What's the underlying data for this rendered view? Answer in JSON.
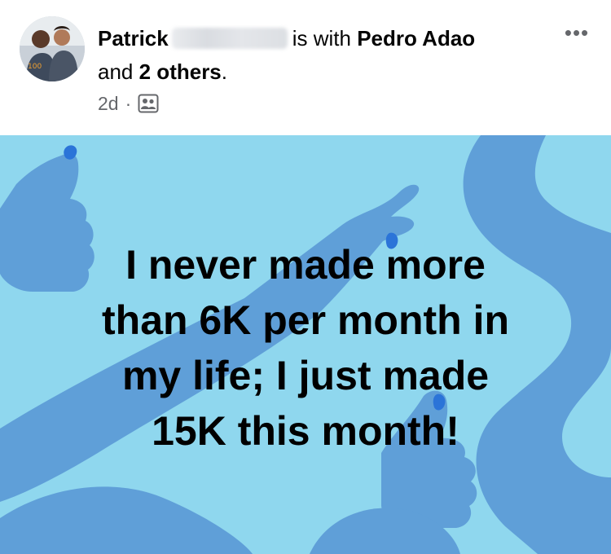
{
  "post": {
    "author": "Patrick",
    "with_text": "is with",
    "tagged_person": "Pedro Adao",
    "and_text": "and",
    "others": "2 others",
    "period": ".",
    "time": "2d",
    "separator": "·",
    "audience_icon": "friends-audience-icon",
    "more_icon": "more-options-icon",
    "more_glyph": "•••",
    "text": "I never made more\nthan 6K per month in\nmy life; I just made\n15K this month!"
  },
  "colors": {
    "background": "#8fd7ee",
    "shapes": "#5f9fd8",
    "accent": "#2b74d8",
    "meta_text": "#65676b"
  }
}
